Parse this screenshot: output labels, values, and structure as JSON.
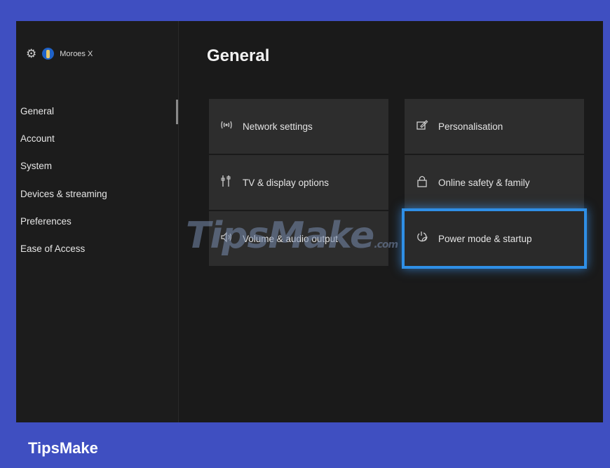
{
  "profile": {
    "gamertag": "Moroes X"
  },
  "sidebar": {
    "items": [
      {
        "label": "General",
        "active": true
      },
      {
        "label": "Account"
      },
      {
        "label": "System"
      },
      {
        "label": "Devices & streaming"
      },
      {
        "label": "Preferences"
      },
      {
        "label": "Ease of Access"
      }
    ]
  },
  "main": {
    "title": "General",
    "tiles": [
      {
        "label": "Network settings",
        "icon": "network-icon"
      },
      {
        "label": "Personalisation",
        "icon": "personalisation-icon"
      },
      {
        "label": "TV & display options",
        "icon": "tv-display-icon"
      },
      {
        "label": "Online safety & family",
        "icon": "lock-icon"
      },
      {
        "label": "Volume & audio output",
        "icon": "speaker-icon"
      },
      {
        "label": "Power mode & startup",
        "icon": "power-leaf-icon",
        "focused": true
      }
    ]
  },
  "watermark": {
    "text": "TipsMake",
    "suffix": ".com"
  },
  "footer": {
    "brand": "TipsMake"
  },
  "colors": {
    "focus": "#2f8fe6",
    "background": "#3f4fc1"
  }
}
